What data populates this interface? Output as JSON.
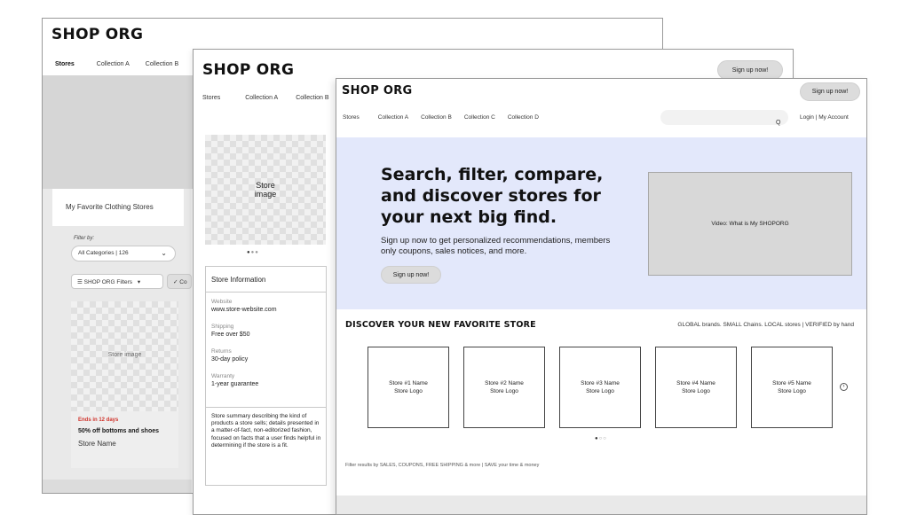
{
  "window_a": {
    "brand": "SHOP ORG",
    "nav": [
      "Stores",
      "Collection A",
      "Collection B"
    ],
    "tab_label": "My Favorite Clothing Stores",
    "filter_label": "Filter by:",
    "category_select": "All Categories | 126",
    "filters_chip": "SHOP ORG Filters",
    "partial_chip": "Co",
    "card": {
      "image_label": "Store image",
      "ends": "Ends in 12 days",
      "deal": "50% off bottoms and shoes",
      "store": "Store Name"
    }
  },
  "window_b": {
    "brand": "SHOP ORG",
    "nav": [
      "Stores",
      "Collection A",
      "Collection B"
    ],
    "signup": "Sign up now!",
    "store_image": "Store\nimage",
    "info": {
      "title": "Store Information",
      "fields": [
        {
          "label": "Website",
          "value": "www.store-website.com"
        },
        {
          "label": "Shipping",
          "value": "Free over $50"
        },
        {
          "label": "Returns",
          "value": "30-day policy"
        },
        {
          "label": "Warranty",
          "value": "1-year guarantee"
        }
      ],
      "summary": "Store summary describing the kind of products a store sells; details presented in a matter-of-fact, non-editorized fashion, focused on facts that a user finds helpful in determining if the store is a fit."
    }
  },
  "window_c": {
    "brand": "SHOP ORG",
    "signup": "Sign up now!",
    "nav": [
      "Stores",
      "Collection A",
      "Collection B",
      "Collection C",
      "Collection D"
    ],
    "search_icon": "Q",
    "login": "Login | My Account",
    "hero": {
      "headline": "Search, filter, compare, and discover stores for your next big find.",
      "sub": "Sign up now to get personalized recommendations, members only coupons, sales notices, and more.",
      "button": "Sign up now!",
      "video": "Video: What is My SHOPORG"
    },
    "discover": {
      "title": "DISCOVER YOUR NEW FAVORITE STORE",
      "tagline": "GLOBAL brands. SMALL Chains. LOCAL stores | VERIFIED by hand",
      "cards": [
        {
          "name": "Store #1 Name",
          "logo": "Store Logo"
        },
        {
          "name": "Store #2 Name",
          "logo": "Store Logo"
        },
        {
          "name": "Store #3 Name",
          "logo": "Store Logo"
        },
        {
          "name": "Store #4 Name",
          "logo": "Store Logo"
        },
        {
          "name": "Store #5 Name",
          "logo": "Store Logo"
        }
      ]
    },
    "filter_note": "Filter results by SALES, COUPONS, FREE SHIPPING & more | SAVE your time & money"
  }
}
